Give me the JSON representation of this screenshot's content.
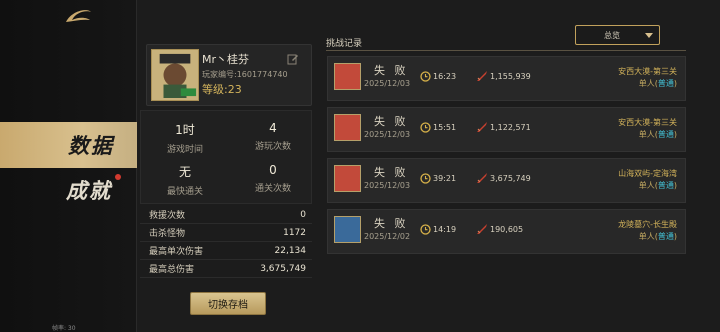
{
  "sidebar": {
    "nav_data": "数据",
    "nav_achievement": "成就",
    "fps": "帧率: 30"
  },
  "player": {
    "name": "Mr丶桂芬",
    "uid": "玩家编号:1601774740",
    "level": "等级:23"
  },
  "stats": {
    "play_time_value": "1时",
    "play_time_label": "游戏时间",
    "play_count_value": "4",
    "play_count_label": "游玩次数",
    "fastest_value": "无",
    "fastest_label": "最快通关",
    "clear_count_value": "0",
    "clear_count_label": "通关次数"
  },
  "details": [
    {
      "k": "救援次数",
      "v": "0"
    },
    {
      "k": "击杀怪物",
      "v": "1172"
    },
    {
      "k": "最高单次伤害",
      "v": "22,134"
    },
    {
      "k": "最高总伤害",
      "v": "3,675,749"
    }
  ],
  "switch_button": "切换存档",
  "records_title": "挑战记录",
  "dropdown_selected": "总览",
  "records": [
    {
      "result": "失 败",
      "date": "2025/12/03",
      "time": "16:23",
      "damage": "1,155,939",
      "stage": "安西大漠-第三关",
      "mode_prefix": "单人(",
      "mode_name": "普通",
      "mode_suffix": ")"
    },
    {
      "result": "失 败",
      "date": "2025/12/03",
      "time": "15:51",
      "damage": "1,122,571",
      "stage": "安西大漠-第三关",
      "mode_prefix": "单人(",
      "mode_name": "普通",
      "mode_suffix": ")"
    },
    {
      "result": "失 败",
      "date": "2025/12/03",
      "time": "39:21",
      "damage": "3,675,749",
      "stage": "山海双屿-定海湾",
      "mode_prefix": "单人(",
      "mode_name": "普通",
      "mode_suffix": ")"
    },
    {
      "result": "失 败",
      "date": "2025/12/02",
      "time": "14:19",
      "damage": "190,605",
      "stage": "龙陵墓穴-长生殿",
      "mode_prefix": "单人(",
      "mode_name": "普通",
      "mode_suffix": ")"
    }
  ],
  "colors": {
    "accent_gold": "#c1a15c",
    "mode_cyan": "#43c2d6",
    "alert_red": "#d23a2f"
  }
}
